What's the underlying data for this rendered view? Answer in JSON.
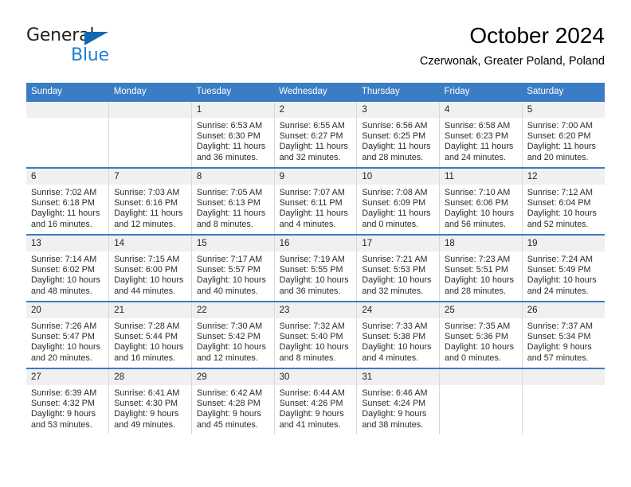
{
  "brand": {
    "name_part1": "General",
    "name_part2": "Blue",
    "triangle_icon": "triangle-icon",
    "accent_color": "#1268b3",
    "blue_text_color": "#1a7fd4"
  },
  "header": {
    "title": "October 2024",
    "location": "Czerwonak, Greater Poland, Poland"
  },
  "calendar": {
    "header_background": "#3b7dc4",
    "header_text_color": "#ffffff",
    "daynum_background": "#f0f0f0",
    "weekday_headers": [
      "Sunday",
      "Monday",
      "Tuesday",
      "Wednesday",
      "Thursday",
      "Friday",
      "Saturday"
    ],
    "weeks": [
      [
        {
          "day": "",
          "sunrise": "",
          "sunset": "",
          "daylight": "",
          "empty": true
        },
        {
          "day": "",
          "sunrise": "",
          "sunset": "",
          "daylight": "",
          "empty": true
        },
        {
          "day": "1",
          "sunrise": "Sunrise: 6:53 AM",
          "sunset": "Sunset: 6:30 PM",
          "daylight": "Daylight: 11 hours and 36 minutes."
        },
        {
          "day": "2",
          "sunrise": "Sunrise: 6:55 AM",
          "sunset": "Sunset: 6:27 PM",
          "daylight": "Daylight: 11 hours and 32 minutes."
        },
        {
          "day": "3",
          "sunrise": "Sunrise: 6:56 AM",
          "sunset": "Sunset: 6:25 PM",
          "daylight": "Daylight: 11 hours and 28 minutes."
        },
        {
          "day": "4",
          "sunrise": "Sunrise: 6:58 AM",
          "sunset": "Sunset: 6:23 PM",
          "daylight": "Daylight: 11 hours and 24 minutes."
        },
        {
          "day": "5",
          "sunrise": "Sunrise: 7:00 AM",
          "sunset": "Sunset: 6:20 PM",
          "daylight": "Daylight: 11 hours and 20 minutes."
        }
      ],
      [
        {
          "day": "6",
          "sunrise": "Sunrise: 7:02 AM",
          "sunset": "Sunset: 6:18 PM",
          "daylight": "Daylight: 11 hours and 16 minutes."
        },
        {
          "day": "7",
          "sunrise": "Sunrise: 7:03 AM",
          "sunset": "Sunset: 6:16 PM",
          "daylight": "Daylight: 11 hours and 12 minutes."
        },
        {
          "day": "8",
          "sunrise": "Sunrise: 7:05 AM",
          "sunset": "Sunset: 6:13 PM",
          "daylight": "Daylight: 11 hours and 8 minutes."
        },
        {
          "day": "9",
          "sunrise": "Sunrise: 7:07 AM",
          "sunset": "Sunset: 6:11 PM",
          "daylight": "Daylight: 11 hours and 4 minutes."
        },
        {
          "day": "10",
          "sunrise": "Sunrise: 7:08 AM",
          "sunset": "Sunset: 6:09 PM",
          "daylight": "Daylight: 11 hours and 0 minutes."
        },
        {
          "day": "11",
          "sunrise": "Sunrise: 7:10 AM",
          "sunset": "Sunset: 6:06 PM",
          "daylight": "Daylight: 10 hours and 56 minutes."
        },
        {
          "day": "12",
          "sunrise": "Sunrise: 7:12 AM",
          "sunset": "Sunset: 6:04 PM",
          "daylight": "Daylight: 10 hours and 52 minutes."
        }
      ],
      [
        {
          "day": "13",
          "sunrise": "Sunrise: 7:14 AM",
          "sunset": "Sunset: 6:02 PM",
          "daylight": "Daylight: 10 hours and 48 minutes."
        },
        {
          "day": "14",
          "sunrise": "Sunrise: 7:15 AM",
          "sunset": "Sunset: 6:00 PM",
          "daylight": "Daylight: 10 hours and 44 minutes."
        },
        {
          "day": "15",
          "sunrise": "Sunrise: 7:17 AM",
          "sunset": "Sunset: 5:57 PM",
          "daylight": "Daylight: 10 hours and 40 minutes."
        },
        {
          "day": "16",
          "sunrise": "Sunrise: 7:19 AM",
          "sunset": "Sunset: 5:55 PM",
          "daylight": "Daylight: 10 hours and 36 minutes."
        },
        {
          "day": "17",
          "sunrise": "Sunrise: 7:21 AM",
          "sunset": "Sunset: 5:53 PM",
          "daylight": "Daylight: 10 hours and 32 minutes."
        },
        {
          "day": "18",
          "sunrise": "Sunrise: 7:23 AM",
          "sunset": "Sunset: 5:51 PM",
          "daylight": "Daylight: 10 hours and 28 minutes."
        },
        {
          "day": "19",
          "sunrise": "Sunrise: 7:24 AM",
          "sunset": "Sunset: 5:49 PM",
          "daylight": "Daylight: 10 hours and 24 minutes."
        }
      ],
      [
        {
          "day": "20",
          "sunrise": "Sunrise: 7:26 AM",
          "sunset": "Sunset: 5:47 PM",
          "daylight": "Daylight: 10 hours and 20 minutes."
        },
        {
          "day": "21",
          "sunrise": "Sunrise: 7:28 AM",
          "sunset": "Sunset: 5:44 PM",
          "daylight": "Daylight: 10 hours and 16 minutes."
        },
        {
          "day": "22",
          "sunrise": "Sunrise: 7:30 AM",
          "sunset": "Sunset: 5:42 PM",
          "daylight": "Daylight: 10 hours and 12 minutes."
        },
        {
          "day": "23",
          "sunrise": "Sunrise: 7:32 AM",
          "sunset": "Sunset: 5:40 PM",
          "daylight": "Daylight: 10 hours and 8 minutes."
        },
        {
          "day": "24",
          "sunrise": "Sunrise: 7:33 AM",
          "sunset": "Sunset: 5:38 PM",
          "daylight": "Daylight: 10 hours and 4 minutes."
        },
        {
          "day": "25",
          "sunrise": "Sunrise: 7:35 AM",
          "sunset": "Sunset: 5:36 PM",
          "daylight": "Daylight: 10 hours and 0 minutes."
        },
        {
          "day": "26",
          "sunrise": "Sunrise: 7:37 AM",
          "sunset": "Sunset: 5:34 PM",
          "daylight": "Daylight: 9 hours and 57 minutes."
        }
      ],
      [
        {
          "day": "27",
          "sunrise": "Sunrise: 6:39 AM",
          "sunset": "Sunset: 4:32 PM",
          "daylight": "Daylight: 9 hours and 53 minutes."
        },
        {
          "day": "28",
          "sunrise": "Sunrise: 6:41 AM",
          "sunset": "Sunset: 4:30 PM",
          "daylight": "Daylight: 9 hours and 49 minutes."
        },
        {
          "day": "29",
          "sunrise": "Sunrise: 6:42 AM",
          "sunset": "Sunset: 4:28 PM",
          "daylight": "Daylight: 9 hours and 45 minutes."
        },
        {
          "day": "30",
          "sunrise": "Sunrise: 6:44 AM",
          "sunset": "Sunset: 4:26 PM",
          "daylight": "Daylight: 9 hours and 41 minutes."
        },
        {
          "day": "31",
          "sunrise": "Sunrise: 6:46 AM",
          "sunset": "Sunset: 4:24 PM",
          "daylight": "Daylight: 9 hours and 38 minutes."
        },
        {
          "day": "",
          "sunrise": "",
          "sunset": "",
          "daylight": "",
          "empty": true
        },
        {
          "day": "",
          "sunrise": "",
          "sunset": "",
          "daylight": "",
          "empty": true
        }
      ]
    ]
  }
}
